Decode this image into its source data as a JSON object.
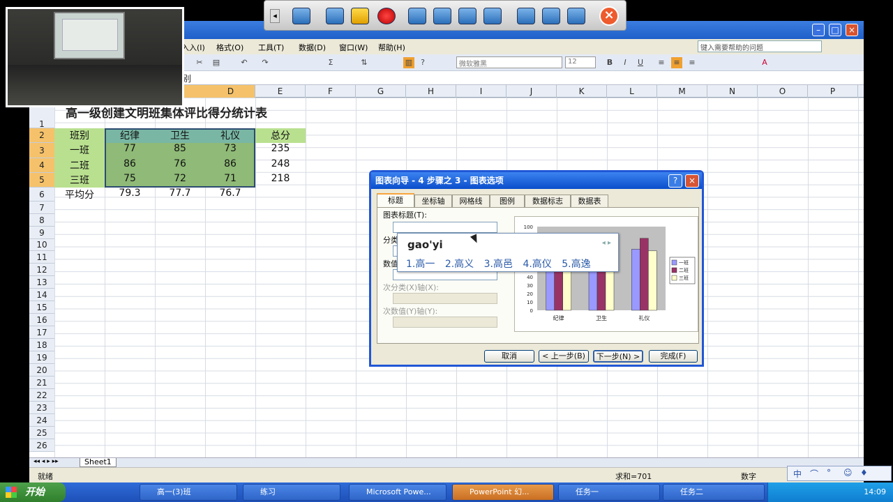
{
  "menubar": {
    "items": [
      "入入(I)",
      "格式(O)",
      "工具(T)",
      "数据(D)",
      "窗口(W)",
      "帮助(H)"
    ],
    "help_placeholder": "键入需要帮助的问题"
  },
  "toolbar": {
    "font": "微软雅黑",
    "size": "12"
  },
  "formula_bar": {
    "content": "别"
  },
  "columns": [
    "D",
    "E",
    "F",
    "G",
    "H",
    "I",
    "J",
    "K",
    "L",
    "M",
    "N",
    "O",
    "P"
  ],
  "rows": [
    "1",
    "2",
    "3",
    "4",
    "5",
    "6",
    "7",
    "8",
    "9",
    "10",
    "11",
    "12",
    "13",
    "14",
    "15",
    "16",
    "17",
    "18",
    "19",
    "20",
    "21",
    "22",
    "23",
    "24",
    "25",
    "26"
  ],
  "sheet": {
    "title": "高一级创建文明班集体评比得分统计表",
    "headers": [
      "班别",
      "纪律",
      "卫生",
      "礼仪",
      "总分"
    ],
    "data_rows": [
      [
        "一班",
        "77",
        "85",
        "73",
        "235"
      ],
      [
        "二班",
        "86",
        "76",
        "86",
        "248"
      ],
      [
        "三班",
        "75",
        "72",
        "71",
        "218"
      ]
    ],
    "average_row": [
      "平均分",
      "79.3",
      "77.7",
      "76.7"
    ]
  },
  "sheet_tab": "Sheet1",
  "status": {
    "ready": "就绪",
    "sum": "求和=701",
    "mode": "数字"
  },
  "dialog": {
    "title": "图表向导 - 4 步骤之 3 - 图表选项",
    "help_button": "?",
    "close_button": "×",
    "tabs": [
      "标题",
      "坐标轴",
      "网格线",
      "图例",
      "数据标志",
      "数据表"
    ],
    "fields": {
      "chart_title": "图表标题(T):",
      "category_prefix": "分类",
      "value_prefix": "数值",
      "secondary_category": "次分类(X)轴(X):",
      "secondary_value": "次数值(Y)轴(Y):"
    },
    "buttons": {
      "cancel": "取消",
      "back": "< 上一步(B)",
      "next": "下一步(N) >",
      "finish": "完成(F)"
    }
  },
  "ime": {
    "composition": "gao'yi",
    "arrows": "◂ ▸",
    "candidates": [
      "1.高一",
      "2.高义",
      "3.高邑",
      "4.高仪",
      "5.高逸"
    ]
  },
  "chart_data": {
    "type": "bar",
    "categories": [
      "纪律",
      "卫生",
      "礼仪"
    ],
    "series": [
      {
        "name": "一班",
        "values": [
          77,
          85,
          73
        ],
        "color": "#9999ff"
      },
      {
        "name": "二班",
        "values": [
          86,
          76,
          86
        ],
        "color": "#993366"
      },
      {
        "name": "三班",
        "values": [
          75,
          72,
          71
        ],
        "color": "#ffffcc"
      }
    ],
    "ylim": [
      0,
      100
    ],
    "yticks": [
      "100",
      "40",
      "30",
      "20",
      "10",
      "0"
    ],
    "legend_position": "right"
  },
  "presentation_toolbar": {
    "close_icon": "×",
    "back_icon": "◂"
  },
  "lang_bar": {
    "items": [
      "中",
      "⌒",
      "°",
      "☺",
      "♦"
    ]
  },
  "taskbar": {
    "start": "开始",
    "tasks": [
      "高一(3)班",
      "练习",
      "Microsoft Powe...",
      "PowerPoint 幻...",
      "任务一",
      "任务二"
    ],
    "clock": "14:09"
  }
}
